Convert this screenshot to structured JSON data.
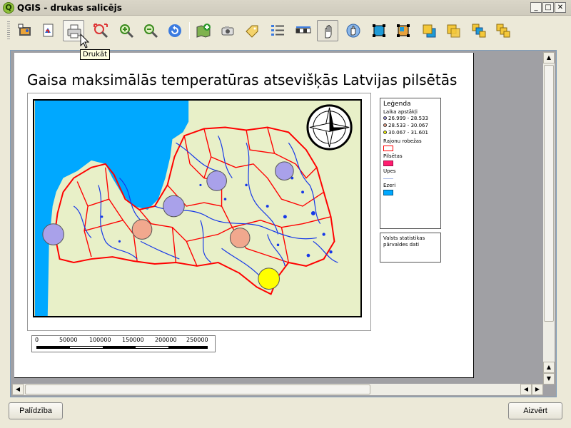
{
  "window": {
    "title": "QGIS - drukas salicējs",
    "app_icon_letter": "Q",
    "minimize_glyph": "_",
    "maximize_glyph": "□",
    "close_glyph": "✕"
  },
  "toolbar": {
    "buttons": [
      {
        "name": "add-image-icon"
      },
      {
        "name": "export-pdf-icon"
      },
      {
        "name": "print-icon",
        "state": "hovered"
      },
      {
        "name": "zoom-full-icon"
      },
      {
        "name": "zoom-in-icon"
      },
      {
        "name": "zoom-out-icon"
      },
      {
        "name": "refresh-icon"
      },
      {
        "name": "add-map-icon"
      },
      {
        "name": "add-image-item-icon"
      },
      {
        "name": "add-label-icon"
      },
      {
        "name": "add-legend-icon"
      },
      {
        "name": "add-scalebar-icon"
      },
      {
        "name": "select-move-icon",
        "state": "active"
      },
      {
        "name": "move-content-icon"
      },
      {
        "name": "group-icon"
      },
      {
        "name": "ungroup-icon"
      },
      {
        "name": "raise-icon"
      },
      {
        "name": "lower-icon"
      },
      {
        "name": "bring-front-icon"
      },
      {
        "name": "send-back-icon"
      }
    ],
    "tooltip": "Drukāt"
  },
  "composer": {
    "map_title": "Gaisa maksimālās temperatūras atsevišķās Latvijas pilsētās",
    "legend": {
      "title": "Leģenda",
      "layer1": "Laika apstākļi",
      "classes": [
        {
          "label": "26.999 - 28.533",
          "color": "#a9a1ea"
        },
        {
          "label": "28.533 - 30.067",
          "color": "#f1a88e"
        },
        {
          "label": "30.067 - 31.601",
          "color": "#ffff00"
        }
      ],
      "layer2": "Rajonu robežas",
      "layer2_color": "#ff0000",
      "layer3": "Pilsētas",
      "layer3_color": "#ff1c6e",
      "layer4": "Upes",
      "layer4_color": "#a7b8e6",
      "layer5": "Ezeri",
      "layer5_color": "#00a8ff"
    },
    "source_text": "Valsts statistikas pārvaldes dati",
    "scale_labels": [
      "0",
      "50000",
      "100000",
      "150000",
      "200000",
      "250000"
    ],
    "colors": {
      "sea": "#00a8ff",
      "land": "#e8f0c8",
      "boundaries": "#ff0000",
      "rivers": "#1638e8"
    }
  },
  "buttons": {
    "help": "Palīdzība",
    "close": "Aizvērt"
  }
}
